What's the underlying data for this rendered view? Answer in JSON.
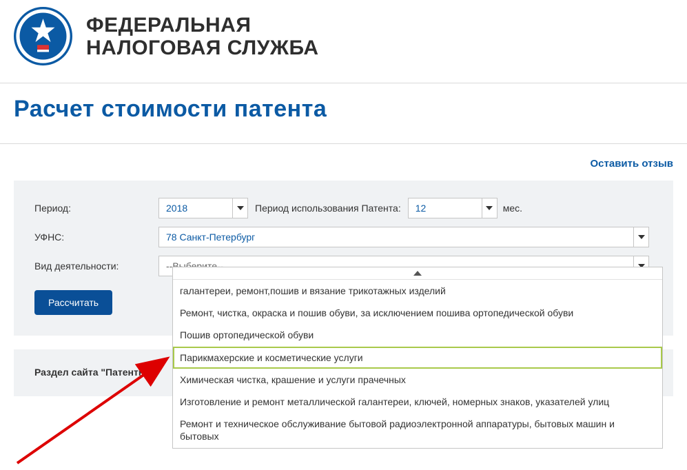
{
  "header": {
    "org_line1": "ФЕДЕРАЛЬНАЯ",
    "org_line2": "НАЛОГОВАЯ СЛУЖБА"
  },
  "page_title": "Расчет стоимости патента",
  "feedback_label": "Оставить отзыв",
  "form": {
    "period_label": "Период:",
    "period_value": "2018",
    "usage_label": "Период использования Патента:",
    "usage_value": "12",
    "usage_unit": "мес.",
    "ufns_label": "УФНС:",
    "ufns_value": "78 Санкт-Петербург",
    "activity_label": "Вид деятельности:",
    "activity_placeholder": "--Выберите--",
    "calc_button": "Рассчитать"
  },
  "dropdown": {
    "items": [
      "галантереи, ремонт,пошив и вязание трикотажных изделий",
      "Ремонт, чистка, окраска и пошив обуви, за исключением пошива ортопедической обуви",
      "Пошив ортопедической обуви",
      "Парикмахерские и косметические услуги",
      "Химическая чистка, крашение и услуги прачечных",
      "Изготовление и ремонт металлической галантереи, ключей, номерных знаков, указателей улиц",
      "Ремонт и техническое обслуживание бытовой радиоэлектронной аппаратуры, бытовых машин и бытовых"
    ],
    "highlighted_index": 3
  },
  "footer": {
    "section_label": "Раздел сайта \"Патентная"
  }
}
